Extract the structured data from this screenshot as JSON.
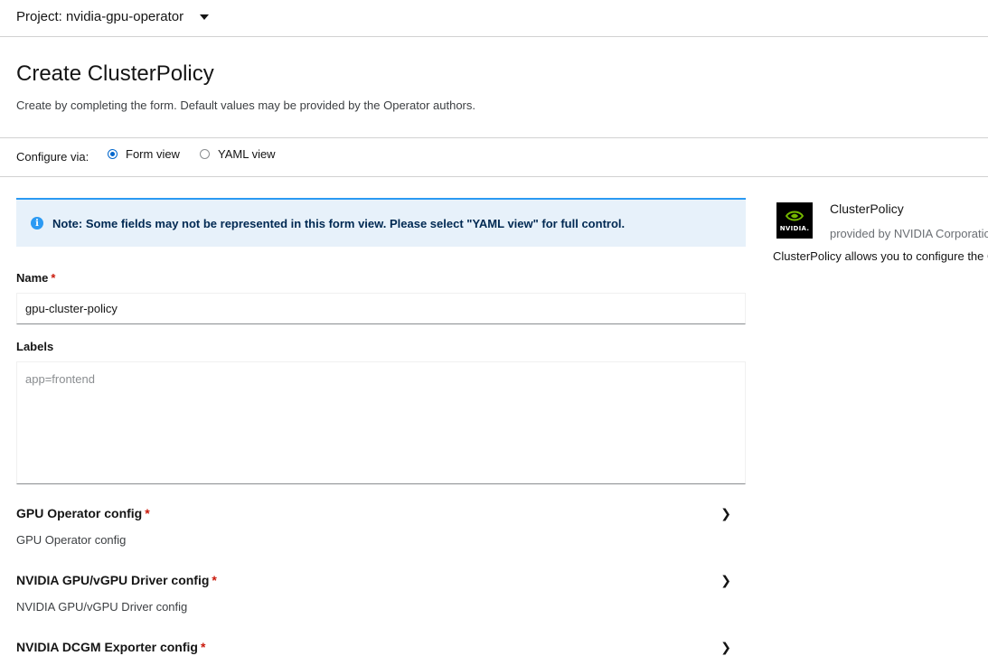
{
  "project": {
    "label": "Project: nvidia-gpu-operator"
  },
  "page": {
    "title": "Create ClusterPolicy",
    "description": "Create by completing the form. Default values may be provided by the Operator authors."
  },
  "configure": {
    "label": "Configure via:",
    "options": [
      {
        "label": "Form view",
        "checked": true
      },
      {
        "label": "YAML view",
        "checked": false
      }
    ]
  },
  "alert": {
    "icon": "info-icon",
    "text": "Note: Some fields may not be represented in this form view. Please select \"YAML view\" for full control.",
    "color": "#2b9af3"
  },
  "form": {
    "name": {
      "label": "Name",
      "required_mark": "*",
      "value": "gpu-cluster-policy"
    },
    "labels": {
      "label": "Labels",
      "placeholder": "app=frontend",
      "value": ""
    },
    "sections": [
      {
        "title": "GPU Operator config",
        "required_mark": "*",
        "description": "GPU Operator config"
      },
      {
        "title": "NVIDIA GPU/vGPU Driver config",
        "required_mark": "*",
        "description": "NVIDIA GPU/vGPU Driver config"
      },
      {
        "title": "NVIDIA DCGM Exporter config",
        "required_mark": "*",
        "description": ""
      }
    ]
  },
  "side": {
    "logo_text": "NVIDIA.",
    "title": "ClusterPolicy",
    "provider": "provided by NVIDIA Corporation",
    "description": "ClusterPolicy allows you to configure the GPU Operator"
  },
  "colors": {
    "accent": "#06c",
    "required": "#c9190b",
    "nvidia_green": "#76b900"
  }
}
